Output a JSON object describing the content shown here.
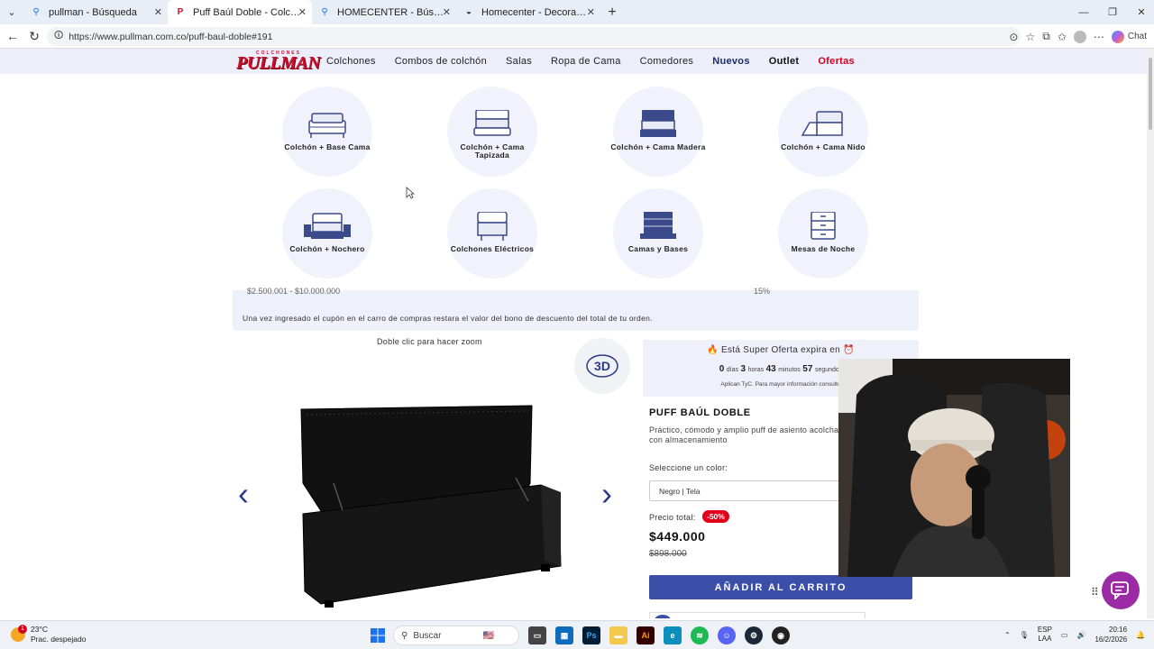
{
  "browser": {
    "tabs": [
      {
        "label": "pullman - Búsqueda",
        "icon": "search-icon",
        "active": false
      },
      {
        "label": "Puff Baúl Doble - Colchones Pullman",
        "icon": "pullman-icon",
        "active": true
      },
      {
        "label": "HOMECENTER - Búsqueda",
        "icon": "search-icon",
        "active": false
      },
      {
        "label": "Homecenter - Decoración para el hogar",
        "icon": "homecenter-icon",
        "active": false
      }
    ],
    "url": "https://www.pullman.com.co/puff-baul-doble#191",
    "chat_label": "Chat"
  },
  "site": {
    "logo_small": "COLCHONES",
    "logo_big": "PULLMAN",
    "menu": [
      "Colchones",
      "Combos de colchón",
      "Salas",
      "Ropa de Cama",
      "Comedores",
      "Nuevos",
      "Outlet",
      "Ofertas"
    ]
  },
  "categories": [
    {
      "label": "Colchón + Base Cama",
      "icon": "bed-base-icon"
    },
    {
      "label": "Colchón + Cama Tapizada",
      "icon": "upholstered-bed-icon"
    },
    {
      "label": "Colchón + Cama Madera",
      "icon": "wood-bed-icon"
    },
    {
      "label": "Colchón + Cama Nido",
      "icon": "trundle-bed-icon"
    },
    {
      "label": "Colchón + Nochero",
      "icon": "bed-nightstand-icon"
    },
    {
      "label": "Colchones Eléctricos",
      "icon": "electric-mattress-icon"
    },
    {
      "label": "Camas y Bases",
      "icon": "bed-frame-icon"
    },
    {
      "label": "Mesas de Noche",
      "icon": "nightstand-icon"
    }
  ],
  "coupon": {
    "range_cut": "$2.500.001 - $10.000.000",
    "percent_cut": "15%",
    "note": "Una vez ingresado el cupón en el carro de compras restara el valor del bono de descuento del total de tu orden."
  },
  "gallery": {
    "zoom_hint": "Doble clic para hacer zoom",
    "btn3d_label": "3D"
  },
  "offer": {
    "headline": "Está Super Oferta expira en",
    "days": "0",
    "days_label": "días",
    "hours": "3",
    "hours_label": "horas",
    "minutes": "43",
    "minutes_label": "minutos",
    "seconds": "57",
    "seconds_label": "segundos",
    "terms": "Aplican TyC. Para mayor información consulte"
  },
  "product": {
    "title": "PUFF BAÚL DOBLE",
    "description": "Práctico, cómodo y amplio puff de asiento acolchado con almacenamiento",
    "color_label": "Seleccione un color:",
    "color_value": "Negro | Tela",
    "price_label": "Precio total:",
    "discount": "-50%",
    "price": "$449.000",
    "old_price": "$898.000",
    "add_to_cart": "AÑADIR AL CARRITO"
  },
  "taskbar": {
    "temp": "23°C",
    "weather": "Prac. despejado",
    "weather_badge": "1",
    "search_placeholder": "Buscar",
    "lang1": "ESP",
    "lang2": "LAA",
    "time": "20:16",
    "date": "16/2/2026"
  },
  "colors": {
    "brand_red": "#c8102e",
    "accent_blue": "#3b4fa8",
    "nav_bg": "#eceefa",
    "discount_red": "#e2001a",
    "chat_purple": "#9b2ba4"
  }
}
